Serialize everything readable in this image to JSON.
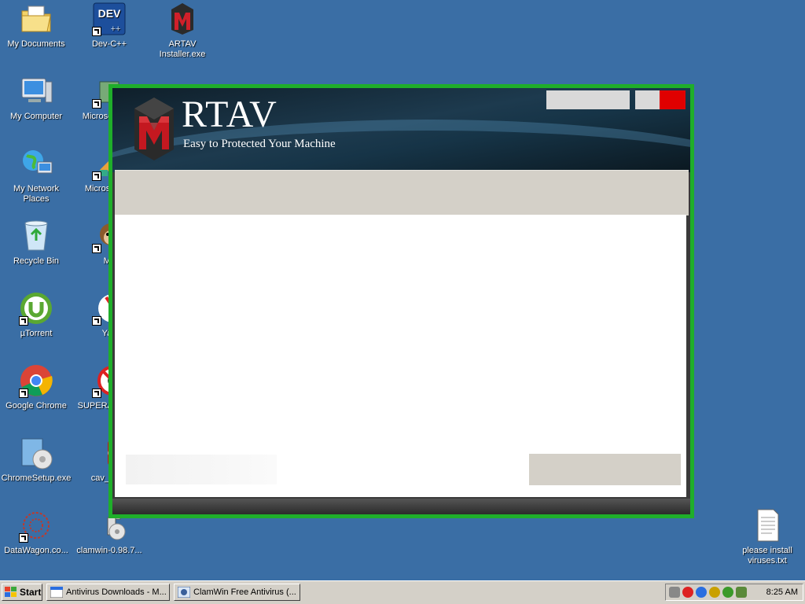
{
  "desktop": {
    "icons": [
      {
        "label": "My Documents",
        "icon": "folder-documents-icon"
      },
      {
        "label": "Dev-C++",
        "icon": "dev-cpp-icon"
      },
      {
        "label": "ARTAV Installer.exe",
        "icon": "artav-installer-icon"
      },
      {
        "label": "My Computer",
        "icon": "computer-icon"
      },
      {
        "label": "Microso Basic",
        "icon": "microsoft-basic-icon"
      },
      {
        "label": "My Network Places",
        "icon": "network-places-icon"
      },
      {
        "label": "Microso C++",
        "icon": "microsoft-cpp-icon"
      },
      {
        "label": "Recycle Bin",
        "icon": "recycle-bin-icon"
      },
      {
        "label": "My",
        "icon": "monkey-icon"
      },
      {
        "label": "µTorrent",
        "icon": "utorrent-icon"
      },
      {
        "label": "Yan",
        "icon": "yandex-icon"
      },
      {
        "label": "Google Chrome",
        "icon": "chrome-icon"
      },
      {
        "label": "SUPERA Free E",
        "icon": "superantispyware-icon"
      },
      {
        "label": "ChromeSetup.exe",
        "icon": "chrome-setup-icon"
      },
      {
        "label": "cav_insta",
        "icon": "cav-installer-icon"
      },
      {
        "label": "DataWagon.co...",
        "icon": "datawagon-icon"
      },
      {
        "label": "clamwin-0.98.7...",
        "icon": "clamwin-installer-icon"
      },
      {
        "label": "please install viruses.txt",
        "icon": "text-file-icon"
      }
    ]
  },
  "installer": {
    "brand_name": "RTAV",
    "tagline": "Easy to Protected Your Machine",
    "colors": {
      "border": "#1fae2a",
      "close": "#e00000",
      "banner": "#1d3a4e"
    }
  },
  "taskbar": {
    "start_label": "Start",
    "tasks": [
      {
        "label": "Antivirus Downloads - M...",
        "icon": "browser-window-icon"
      },
      {
        "label": "ClamWin Free Antivirus (...",
        "icon": "clamwin-window-icon"
      }
    ],
    "clock": "8:25 AM"
  }
}
